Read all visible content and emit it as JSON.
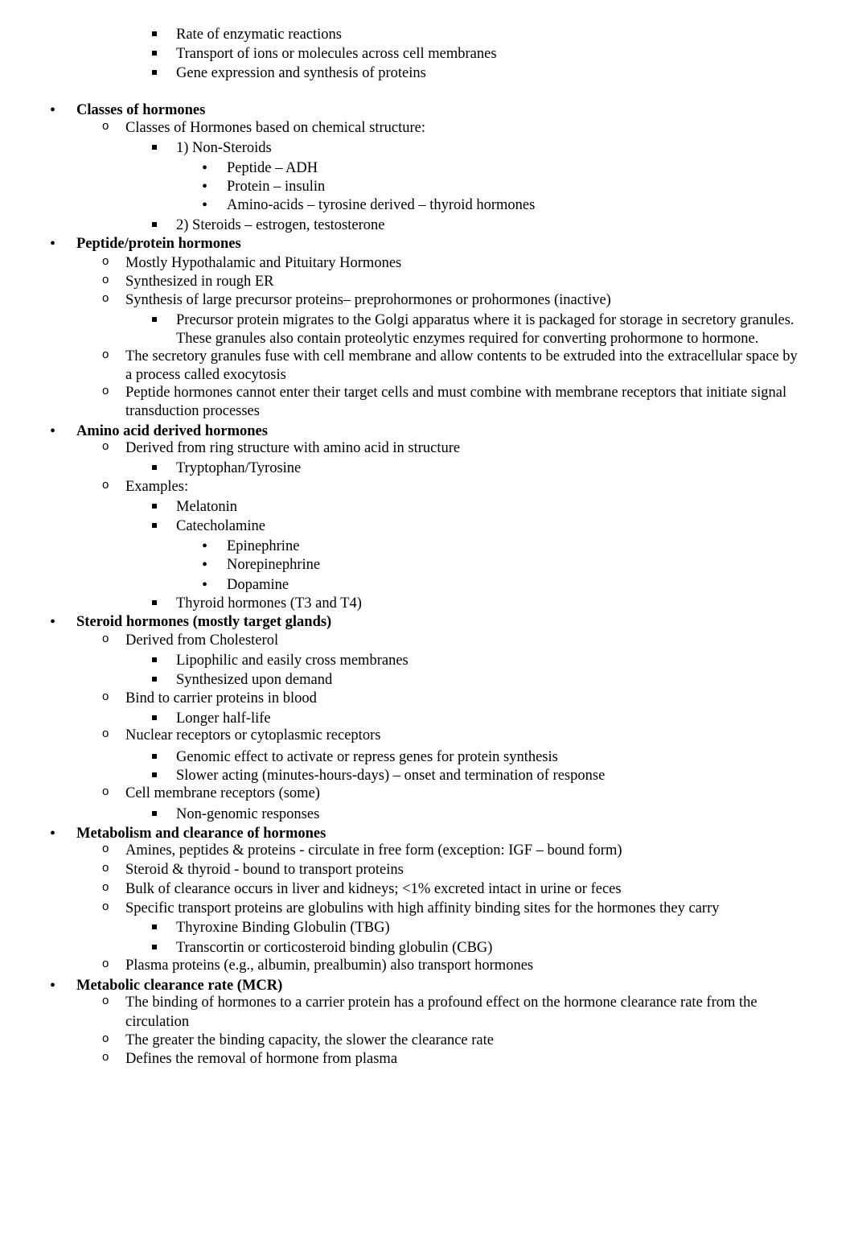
{
  "document": {
    "lines": [
      {
        "level": 3,
        "text": "Rate of enzymatic reactions"
      },
      {
        "level": 3,
        "text": "Transport of ions or molecules across cell membranes"
      },
      {
        "level": 3,
        "text": "Gene expression and synthesis of proteins"
      },
      {
        "level": 1,
        "text": "Classes of hormones"
      },
      {
        "level": 2,
        "text": "Classes of Hormones based on chemical structure:"
      },
      {
        "level": 3,
        "text": "1) Non-Steroids"
      },
      {
        "level": 4,
        "text": "Peptide – ADH"
      },
      {
        "level": 4,
        "text": "Protein – insulin"
      },
      {
        "level": 4,
        "text": "Amino-acids – tyrosine derived – thyroid hormones"
      },
      {
        "level": 3,
        "text": "2) Steroids – estrogen, testosterone"
      },
      {
        "level": 1,
        "text": "Peptide/protein hormones"
      },
      {
        "level": 2,
        "text": "Mostly Hypothalamic and Pituitary Hormones"
      },
      {
        "level": 2,
        "text": "Synthesized in rough ER"
      },
      {
        "level": 2,
        "text": "Synthesis of large precursor proteins– preprohormones or prohormones (inactive)"
      },
      {
        "level": 3,
        "text": "Precursor protein migrates to the Golgi apparatus where it is packaged for storage in secretory granules."
      },
      {
        "level": 0,
        "wrap": 3,
        "text": "These granules also contain proteolytic enzymes required for converting prohormone to hormone."
      },
      {
        "level": 2,
        "text": "The secretory granules fuse with cell membrane and allow contents to be extruded into the extracellular space by"
      },
      {
        "level": 0,
        "wrap": 2,
        "text": "a process called exocytosis"
      },
      {
        "level": 2,
        "text": "Peptide hormones cannot enter their target cells and must combine with membrane receptors that initiate signal"
      },
      {
        "level": 0,
        "wrap": 2,
        "text": "transduction processes"
      },
      {
        "level": 1,
        "text": "Amino acid derived hormones"
      },
      {
        "level": 2,
        "text": "Derived from ring structure with amino acid in structure"
      },
      {
        "level": 3,
        "text": "Tryptophan/Tyrosine"
      },
      {
        "level": 2,
        "text": "Examples:"
      },
      {
        "level": 3,
        "text": "Melatonin"
      },
      {
        "level": 3,
        "text": "Catecholamine"
      },
      {
        "level": 4,
        "text": "Epinephrine"
      },
      {
        "level": 4,
        "text": "Norepinephrine"
      },
      {
        "level": 4,
        "text": "Dopamine"
      },
      {
        "level": 3,
        "text": "Thyroid hormones (T3 and T4)"
      },
      {
        "level": 1,
        "text": "Steroid hormones (mostly target glands)"
      },
      {
        "level": 2,
        "text": "Derived from Cholesterol"
      },
      {
        "level": 3,
        "text": "Lipophilic and easily cross membranes"
      },
      {
        "level": 3,
        "text": "Synthesized upon demand"
      },
      {
        "level": 2,
        "text": "Bind to carrier proteins in blood"
      },
      {
        "level": 3,
        "text": "Longer half-life"
      },
      {
        "level": 2,
        "text": "Nuclear receptors or cytoplasmic receptors"
      },
      {
        "level": 3,
        "text": "Genomic effect to activate or repress genes for protein synthesis"
      },
      {
        "level": 3,
        "text": "Slower acting (minutes-hours-days) – onset and termination of response"
      },
      {
        "level": 2,
        "text": "Cell membrane receptors (some)"
      },
      {
        "level": 3,
        "text": "Non-genomic responses"
      },
      {
        "level": 1,
        "text": "Metabolism and clearance of hormones"
      },
      {
        "level": 2,
        "text": "Amines, peptides & proteins - circulate in free form (exception: IGF – bound form)"
      },
      {
        "level": 2,
        "text": "Steroid & thyroid - bound to transport proteins"
      },
      {
        "level": 2,
        "text": "Bulk of clearance occurs in liver and kidneys; <1% excreted intact in urine or feces"
      },
      {
        "level": 2,
        "text": "Specific transport proteins are globulins with high affinity binding sites for the hormones they carry"
      },
      {
        "level": 3,
        "text": "Thyroxine Binding Globulin (TBG)"
      },
      {
        "level": 3,
        "text": "Transcortin or corticosteroid binding globulin (CBG)"
      },
      {
        "level": 2,
        "text": "Plasma proteins (e.g., albumin, prealbumin) also transport hormones"
      },
      {
        "level": 1,
        "text": "Metabolic clearance rate (MCR)"
      },
      {
        "level": 2,
        "text": "The binding of hormones to a carrier protein has a profound effect on the hormone clearance rate from the"
      },
      {
        "level": 0,
        "wrap": 2,
        "text": "circulation"
      },
      {
        "level": 2,
        "text": "The greater the binding capacity, the slower the clearance rate"
      },
      {
        "level": 2,
        "text": "Defines the removal of hormone from plasma"
      }
    ],
    "markers": {
      "l1": "•",
      "l2": "o",
      "l4": "•"
    }
  }
}
